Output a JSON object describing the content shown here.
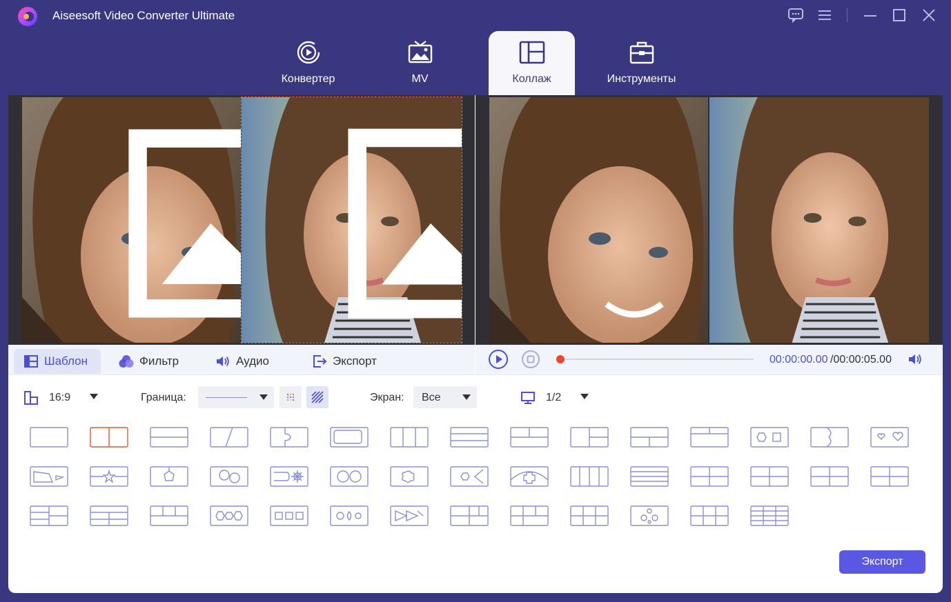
{
  "window": {
    "title": "Aiseesoft Video Converter Ultimate"
  },
  "tabs": [
    {
      "label": "Конвертер",
      "icon": "converter-icon"
    },
    {
      "label": "MV",
      "icon": "mv-icon"
    },
    {
      "label": "Коллаж",
      "icon": "collage-icon",
      "active": true
    },
    {
      "label": "Инструменты",
      "icon": "toolbox-icon"
    }
  ],
  "subtabs": [
    {
      "label": "Шаблон",
      "icon": "template-icon",
      "active": true
    },
    {
      "label": "Фильтр",
      "icon": "filter-icon"
    },
    {
      "label": "Аудио",
      "icon": "audio-icon"
    },
    {
      "label": "Экспорт",
      "icon": "export-icon"
    }
  ],
  "player": {
    "current_time": "00:00:00.00",
    "total_time": "/00:00:05.00",
    "progress": 0
  },
  "options": {
    "aspect": "16:9",
    "border_label": "Граница:",
    "screen_label": "Экран:",
    "screen_value": "Все",
    "page": "1/2"
  },
  "export_button": "Экспорт",
  "colors": {
    "accent": "#5a57e3",
    "header": "#3a3781",
    "template_stroke": "#8a8fd6",
    "template_selected": "#f0562e"
  },
  "templates_count": 43,
  "selected_template_index": 1
}
